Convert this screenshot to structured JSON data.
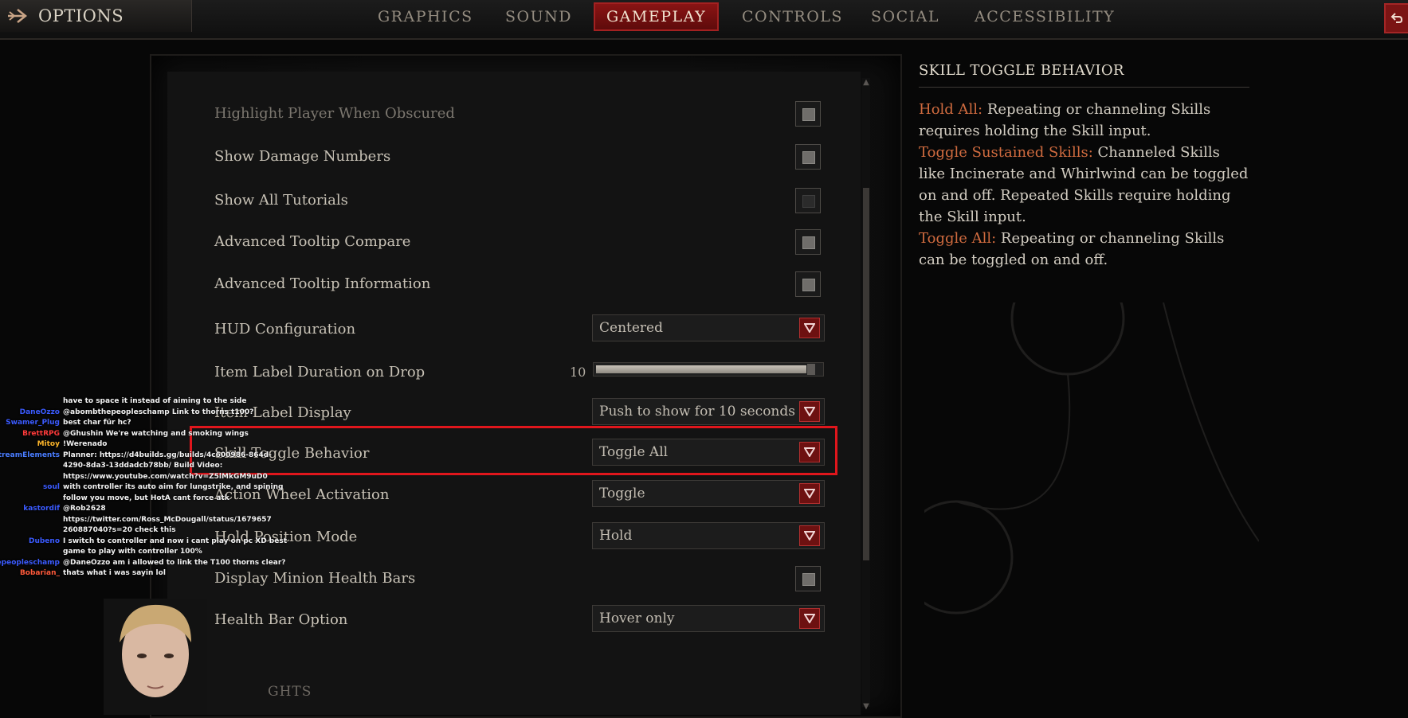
{
  "header": {
    "title": "OPTIONS",
    "tabs": [
      {
        "label": "GRAPHICS",
        "active": false
      },
      {
        "label": "SOUND",
        "active": false
      },
      {
        "label": "GAMEPLAY",
        "active": true
      },
      {
        "label": "CONTROLS",
        "active": false
      },
      {
        "label": "SOCIAL",
        "active": false
      },
      {
        "label": "ACCESSIBILITY",
        "active": false
      }
    ]
  },
  "settings": {
    "rows": [
      {
        "label": "Highlight Player When Obscured",
        "type": "checkbox",
        "checked": true
      },
      {
        "label": "Show Damage Numbers",
        "type": "checkbox",
        "checked": true
      },
      {
        "label": "Show All Tutorials",
        "type": "checkbox",
        "checked": false
      },
      {
        "label": "Advanced Tooltip Compare",
        "type": "checkbox",
        "checked": true
      },
      {
        "label": "Advanced Tooltip Information",
        "type": "checkbox",
        "checked": true
      },
      {
        "label": "HUD Configuration",
        "type": "dropdown",
        "value": "Centered"
      },
      {
        "label": "Item Label Duration on Drop",
        "type": "slider",
        "value": "10",
        "fill_fraction": 0.97
      },
      {
        "label": "Item Label Display",
        "type": "dropdown",
        "value": "Push to show for 10 seconds"
      },
      {
        "label": "Skill Toggle Behavior",
        "type": "dropdown",
        "value": "Toggle All"
      },
      {
        "label": "Action Wheel Activation",
        "type": "dropdown",
        "value": "Toggle"
      },
      {
        "label": "Hold Position Mode",
        "type": "dropdown",
        "value": "Hold"
      },
      {
        "label": "Display Minion Health Bars",
        "type": "checkbox",
        "checked": true
      },
      {
        "label": "Health Bar Option",
        "type": "dropdown",
        "value": "Hover only"
      }
    ],
    "section_partial": "GHTS"
  },
  "description": {
    "title": "SKILL TOGGLE BEHAVIOR",
    "items": [
      {
        "key": "Hold All:",
        "text": " Repeating or channeling Skills requires holding the Skill input."
      },
      {
        "key": "Toggle Sustained Skills:",
        "text": " Channeled Skills like Incinerate and Whirlwind can be toggled on and off. Repeated Skills require holding the Skill input."
      },
      {
        "key": "Toggle All:",
        "text": " Repeating or channeling Skills can be toggled on and off."
      }
    ]
  },
  "chat": [
    {
      "user": "",
      "msg": "have to space it instead of aiming to the side",
      "user_color": "#4aa0ff"
    },
    {
      "user": "DaneOzzo",
      "msg": "@abombthepeopleschamp Link to thorns t100?",
      "user_color": "#3b5bff"
    },
    {
      "user": "Swamer_Plug",
      "msg": "best char für hc?",
      "user_color": "#3b5bff"
    },
    {
      "user": "BrettRPG",
      "msg": "@Ghushin We're watching and smoking wings",
      "user_color": "#ff3b3b"
    },
    {
      "user": "Mitoy",
      "msg": "!Werenado",
      "user_color": "#ffb72b"
    },
    {
      "user": "StreamElements",
      "msg": "Planner: https://d4builds.gg/builds/4c600986-864d-",
      "user_color": "#4a7dff"
    },
    {
      "user": "",
      "msg": "4290-8da3-13ddadcb78bb/ Build Video:",
      "user_color": "#4a7dff"
    },
    {
      "user": "",
      "msg": "https://www.youtube.com/watch?v=Z5lMkGM9uD0",
      "user_color": "#4a7dff"
    },
    {
      "user": "soul",
      "msg": "with controller its auto aim for lungstrike, and spining",
      "user_color": "#3b5bff"
    },
    {
      "user": "",
      "msg": "follow you move, but HotA cant force atk",
      "user_color": "#3b5bff"
    },
    {
      "user": "kastordif",
      "msg": "@Rob2628",
      "user_color": "#3b5bff"
    },
    {
      "user": "",
      "msg": "https://twitter.com/Ross_McDougall/status/1679657",
      "user_color": "#3b5bff"
    },
    {
      "user": "",
      "msg": "260887040?s=20 check this",
      "user_color": "#3b5bff"
    },
    {
      "user": "Dubeno",
      "msg": "I switch to controller and now i cant play on pc XD best",
      "user_color": "#3b5bff"
    },
    {
      "user": "",
      "msg": "game to play with controller 100%",
      "user_color": "#3b5bff"
    },
    {
      "user": "abombthepeopleschamp",
      "msg": "@DaneOzzo am i allowed to link the T100 thorns clear?",
      "user_color": "#3b5bff"
    },
    {
      "user": "Bobarian_",
      "msg": "thats what i was sayin lol",
      "user_color": "#ff5a3b"
    }
  ],
  "colors": {
    "accent_red": "#8a1414",
    "highlight_outline": "#e0161c",
    "desc_key": "#d06b3f"
  }
}
